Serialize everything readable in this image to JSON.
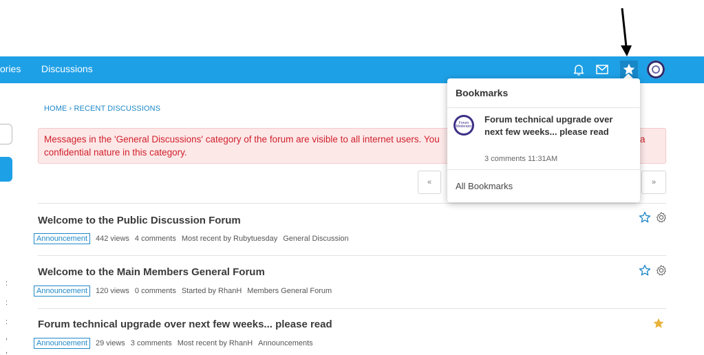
{
  "topbar": {
    "nav_categories": "ories",
    "nav_discussions": "Discussions"
  },
  "icons": {
    "bell": "bell-icon",
    "mail": "mail-icon",
    "bookmark_star": "star-icon",
    "avatar": "avatar"
  },
  "colors": {
    "topbar": "#1ea0e6",
    "link": "#1e88c8",
    "alert_text": "#d0202b",
    "alert_bg": "#fde8e8",
    "starred": "#e8b33a"
  },
  "breadcrumb": "HOME › RECENT DISCUSSIONS",
  "alert": {
    "line1": "Messages in the 'General Discussions' category of the forum are visible to all internet users. You",
    "line1_end": "a",
    "line2": "confidential nature in this category."
  },
  "pager": {
    "prev": "«",
    "next": "»"
  },
  "bookmarks_popup": {
    "title": "Bookmarks",
    "item": {
      "avatar_text": "Forum Moderator",
      "title": "Forum technical upgrade over next few weeks... please read",
      "meta": "3 comments 11:31AM"
    },
    "all_link": "All Bookmarks"
  },
  "discussions": [
    {
      "title": "Welcome to the Public Discussion Forum",
      "badge": "Announcement",
      "views": "442 views",
      "comments": "4 comments",
      "by": "Most recent by Rubytuesday",
      "category": "General Discussion",
      "starred": false
    },
    {
      "title": "Welcome to the Main Members General Forum",
      "badge": "Announcement",
      "views": "120 views",
      "comments": "0 comments",
      "by": "Started by RhanH",
      "category": "Members General Forum",
      "starred": false
    },
    {
      "title": "Forum technical upgrade over next few weeks... please read",
      "badge": "Announcement",
      "views": "29 views",
      "comments": "3 comments",
      "by": "Most recent by RhanH",
      "category": "Announcements",
      "starred": true
    }
  ],
  "left_edge_marks": [
    ":",
    ":",
    ":",
    ",",
    ","
  ]
}
